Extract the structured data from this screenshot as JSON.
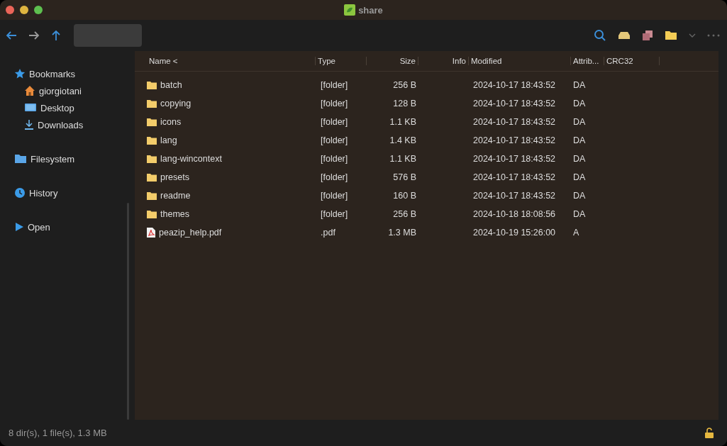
{
  "window": {
    "title": "share"
  },
  "sidebar": {
    "items": [
      {
        "label": "Bookmarks",
        "kind": "bookmarks",
        "children": [
          {
            "label": "giorgiotani",
            "kind": "home"
          },
          {
            "label": "Desktop",
            "kind": "desktop"
          },
          {
            "label": "Downloads",
            "kind": "downloads"
          }
        ]
      },
      {
        "label": "Filesystem",
        "kind": "filesystem"
      },
      {
        "label": "History",
        "kind": "history"
      },
      {
        "label": "Open",
        "kind": "open"
      }
    ]
  },
  "table": {
    "columns": [
      "Name <",
      "Type",
      "Size",
      "Info",
      "Modified",
      "Attrib...",
      "CRC32"
    ],
    "rows": [
      {
        "kind": "folder",
        "cells": [
          "batch",
          "[folder]",
          "256 B",
          "",
          "2024-10-17 18:43:52",
          "DA"
        ]
      },
      {
        "kind": "folder",
        "cells": [
          "copying",
          "[folder]",
          "128 B",
          "",
          "2024-10-17 18:43:52",
          "DA"
        ]
      },
      {
        "kind": "folder",
        "cells": [
          "icons",
          "[folder]",
          "1.1 KB",
          "",
          "2024-10-17 18:43:52",
          "DA"
        ]
      },
      {
        "kind": "folder",
        "cells": [
          "lang",
          "[folder]",
          "1.4 KB",
          "",
          "2024-10-17 18:43:52",
          "DA"
        ]
      },
      {
        "kind": "folder",
        "cells": [
          "lang-wincontext",
          "[folder]",
          "1.1 KB",
          "",
          "2024-10-17 18:43:52",
          "DA"
        ]
      },
      {
        "kind": "folder",
        "cells": [
          "presets",
          "[folder]",
          "576 B",
          "",
          "2024-10-17 18:43:52",
          "DA"
        ]
      },
      {
        "kind": "folder",
        "cells": [
          "readme",
          "[folder]",
          "160 B",
          "",
          "2024-10-17 18:43:52",
          "DA"
        ]
      },
      {
        "kind": "folder",
        "cells": [
          "themes",
          "[folder]",
          "256 B",
          "",
          "2024-10-18 18:08:56",
          "DA"
        ]
      },
      {
        "kind": "pdf",
        "cells": [
          "peazip_help.pdf",
          ".pdf",
          "1.3 MB",
          "",
          "2024-10-19 15:26:00",
          "A"
        ]
      }
    ]
  },
  "status_bar": {
    "text": "8 dir(s), 1 file(s), 1.3 MB"
  }
}
